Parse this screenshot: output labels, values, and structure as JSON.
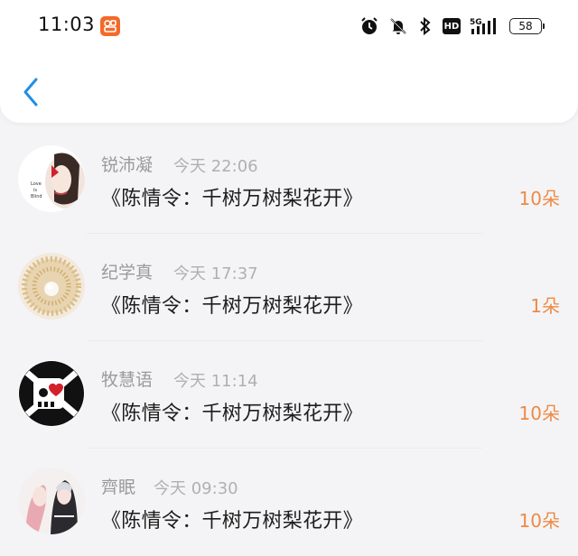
{
  "status_bar": {
    "time": "11:03",
    "signal_label": "5G",
    "battery": "58",
    "hd_label": "HD"
  },
  "nav": {
    "back_icon": "chevron-left-icon"
  },
  "gifts": [
    {
      "name": "锐沛凝",
      "time": "今天 22:06",
      "title": "《陈情令：千树万树梨花开》",
      "amount": "10朵"
    },
    {
      "name": "纪学真",
      "time": "今天 17:37",
      "title": "《陈情令：千树万树梨花开》",
      "amount": "1朵"
    },
    {
      "name": "牧慧语",
      "time": "今天 11:14",
      "title": "《陈情令：千树万树梨花开》",
      "amount": "10朵"
    },
    {
      "name": "齊眠",
      "time": "今天 09:30",
      "title": "《陈情令：千树万树梨花开》",
      "amount": "10朵"
    }
  ],
  "colors": {
    "accent_orange": "#ee8a45",
    "back_blue": "#1f8fe8",
    "app_badge": "#f36a2a"
  }
}
